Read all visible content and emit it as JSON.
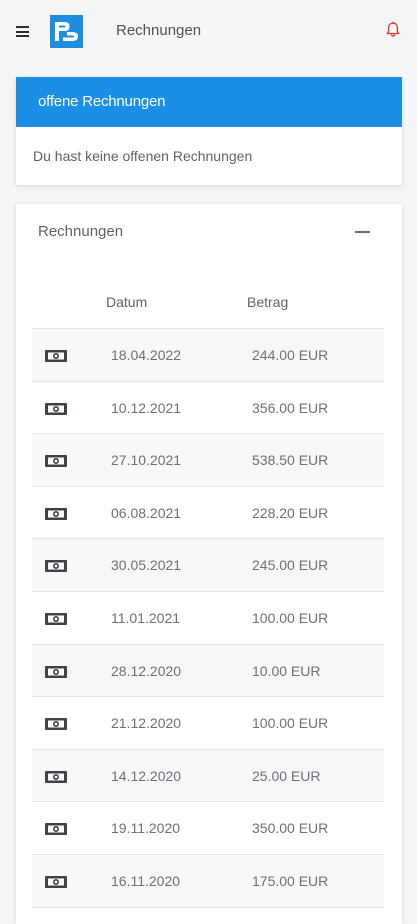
{
  "header": {
    "title": "Rechnungen",
    "menu_icon": "hamburger-menu-icon",
    "logo_text": "PD",
    "notification_icon": "bell-icon",
    "colors": {
      "brand": "#1e8de0",
      "bell": "#e53935"
    }
  },
  "open_invoices": {
    "heading": "offene Rechnungen",
    "message": "Du hast keine offenen Rechnungen",
    "colors": {
      "header_bg": "#1b8ee6"
    }
  },
  "invoices": {
    "title": "Rechnungen",
    "collapse_icon": "minus-icon",
    "columns": {
      "date": "Datum",
      "amount": "Betrag"
    },
    "row_icon": "banknote-icon",
    "rows": [
      {
        "date": "18.04.2022",
        "amount": "244.00 EUR"
      },
      {
        "date": "10.12.2021",
        "amount": "356.00 EUR"
      },
      {
        "date": "27.10.2021",
        "amount": "538.50 EUR"
      },
      {
        "date": "06.08.2021",
        "amount": "228.20 EUR"
      },
      {
        "date": "30.05.2021",
        "amount": "245.00 EUR"
      },
      {
        "date": "11.01.2021",
        "amount": "100.00 EUR"
      },
      {
        "date": "28.12.2020",
        "amount": "10.00 EUR"
      },
      {
        "date": "21.12.2020",
        "amount": "100.00 EUR"
      },
      {
        "date": "14.12.2020",
        "amount": "25.00 EUR"
      },
      {
        "date": "19.11.2020",
        "amount": "350.00 EUR"
      },
      {
        "date": "16.11.2020",
        "amount": "175.00 EUR"
      }
    ]
  }
}
